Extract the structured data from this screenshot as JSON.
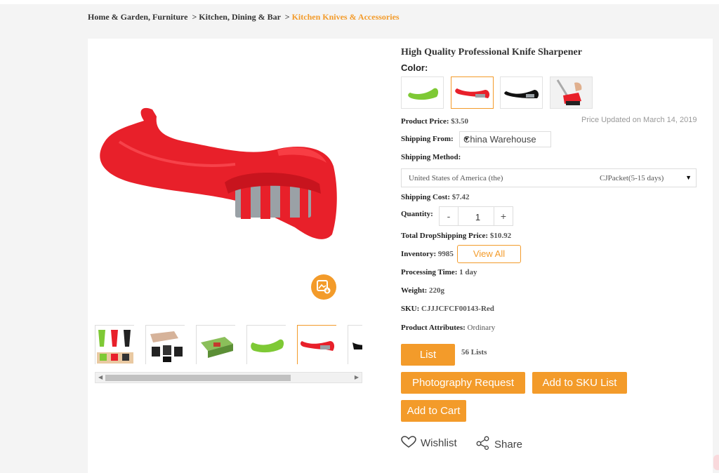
{
  "breadcrumb": {
    "level1": "Home & Garden, Furniture",
    "sep1": ">",
    "level2": "Kitchen, Dining & Bar",
    "sep2": ">",
    "level3": "Kitchen Knives & Accessories"
  },
  "product": {
    "title": "High Quality Professional Knife Sharpener",
    "color_label": "Color:",
    "price_label": "Product Price:",
    "price_value": "$3.50",
    "price_updated": "Price Updated on March 14, 2019",
    "shipping_from_label": "Shipping From:",
    "shipping_from_value": "China Warehouse",
    "shipping_method_label": "Shipping Method:",
    "shipping_country": "United States of America (the)",
    "shipping_method_value": "CJPacket(5-15 days)",
    "shipping_cost_label": "Shipping Cost:",
    "shipping_cost_value": "$7.42",
    "quantity_label": "Quantity:",
    "quantity_minus": "-",
    "quantity_value": "1",
    "quantity_plus": "+",
    "total_label": "Total DropShipping Price:",
    "total_value": "$10.92",
    "inventory_label": "Inventory:",
    "inventory_value": "9985",
    "view_all": "View All",
    "processing_label": "Processing Time:",
    "processing_value": "1 day",
    "weight_label": "Weight:",
    "weight_value": "220g",
    "sku_label": "SKU:",
    "sku_value": "CJJJCFCF00143-Red",
    "attributes_label": "Product Attributes:",
    "attributes_value": "Ordinary"
  },
  "actions": {
    "list": "List",
    "list_count": "56 Lists",
    "photography": "Photography Request",
    "add_sku": "Add to SKU List",
    "add_cart": "Add to Cart",
    "wishlist": "Wishlist",
    "share": "Share"
  },
  "swatches": [
    "green-sharpener",
    "red-sharpener",
    "black-sharpener",
    "in-use-photo"
  ],
  "selected_swatch": "red-sharpener",
  "colors": {
    "accent": "#f39b2a",
    "product_red": "#e8202a",
    "background": "#f4f4f4"
  }
}
